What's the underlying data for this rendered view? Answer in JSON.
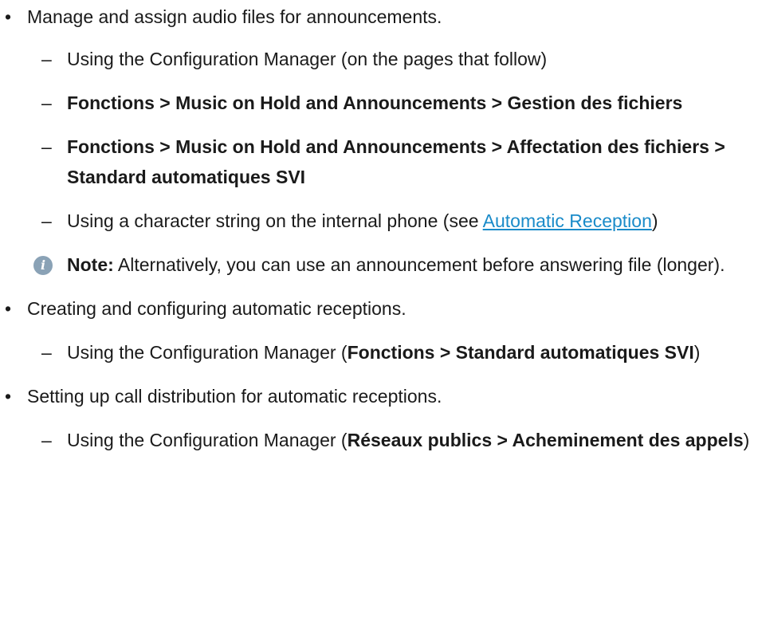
{
  "items": [
    {
      "text": "Manage and assign audio files for announcements.",
      "subitems": [
        {
          "text": "Using the Configuration Manager (on the pages that follow)"
        },
        {
          "path_bold": "Fonctions > Music on Hold and Announcements > Gestion des fichiers"
        },
        {
          "path_bold": "Fonctions > Music on Hold and Announcements > Affectation des fichiers > Standard automatiques SVI"
        },
        {
          "prefix": "Using a character string on the internal phone (see ",
          "link": "Automatic Reception",
          "suffix": ")"
        }
      ],
      "note": {
        "label": "Note:",
        "text": " Alternatively, you can use an announcement before answering file (longer)."
      }
    },
    {
      "text": "Creating and configuring automatic receptions.",
      "subitems": [
        {
          "prefix": "Using the Configuration Manager (",
          "bold": "Fonctions > Standard automatiques SVI",
          "suffix": ")"
        }
      ]
    },
    {
      "text": "Setting up call distribution for automatic receptions.",
      "subitems": [
        {
          "prefix": "Using the Configuration Manager (",
          "bold": "Réseaux publics > Acheminement des appels",
          "suffix": ")"
        }
      ]
    }
  ],
  "bullet_char": "•",
  "dash_char": "–",
  "note_icon_glyph": "i",
  "colors": {
    "text": "#1a1a1a",
    "link": "#1a8bc9",
    "note_icon": "#8aa2b6"
  }
}
